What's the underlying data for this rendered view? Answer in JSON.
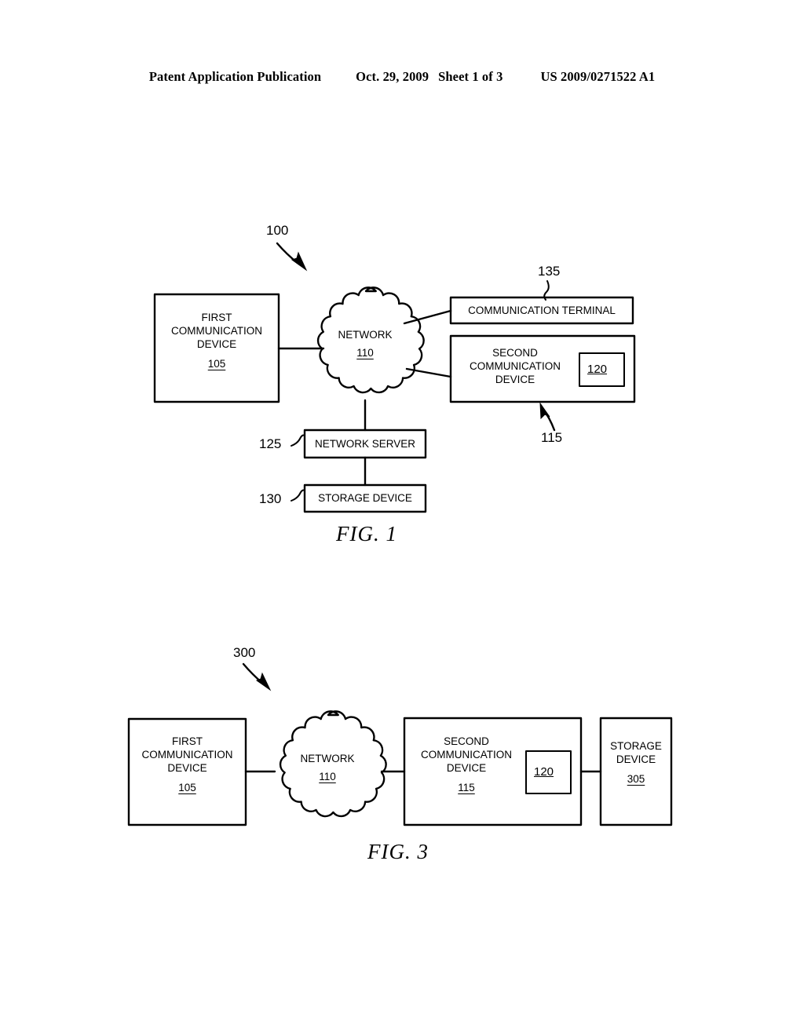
{
  "header": {
    "publication": "Patent Application Publication",
    "date": "Oct. 29, 2009",
    "sheet": "Sheet 1 of 3",
    "doc_number": "US 2009/0271522 A1"
  },
  "figures": [
    {
      "caption": "FIG. 1",
      "system_ref": "100",
      "nodes": {
        "first_device": {
          "line1": "FIRST",
          "line2": "COMMUNICATION",
          "line3": "DEVICE",
          "ref": "105"
        },
        "network": {
          "label": "NETWORK",
          "ref": "110"
        },
        "communication_terminal": {
          "label": "COMMUNICATION TERMINAL",
          "ref": "135"
        },
        "second_device": {
          "line1": "SECOND",
          "line2": "COMMUNICATION",
          "line3": "DEVICE",
          "ref": "115",
          "inner_ref": "120"
        },
        "network_server": {
          "label": "NETWORK SERVER",
          "ref": "125"
        },
        "storage_device": {
          "label": "STORAGE DEVICE",
          "ref": "130"
        }
      }
    },
    {
      "caption": "FIG. 3",
      "system_ref": "300",
      "nodes": {
        "first_device": {
          "line1": "FIRST",
          "line2": "COMMUNICATION",
          "line3": "DEVICE",
          "ref": "105"
        },
        "network": {
          "label": "NETWORK",
          "ref": "110"
        },
        "second_device": {
          "line1": "SECOND",
          "line2": "COMMUNICATION",
          "line3": "DEVICE",
          "ref": "115",
          "inner_ref": "120"
        },
        "storage_device": {
          "line1": "STORAGE",
          "line2": "DEVICE",
          "ref": "305"
        }
      }
    }
  ],
  "colors": {
    "ink": "#000000",
    "paper": "#ffffff"
  }
}
